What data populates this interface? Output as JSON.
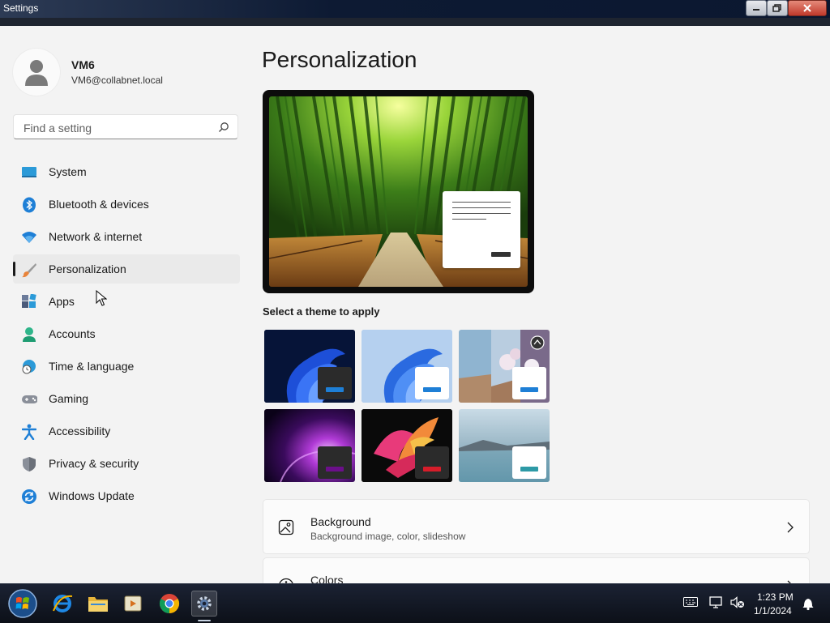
{
  "window": {
    "title": "Settings"
  },
  "profile": {
    "name": "VM6",
    "email": "VM6@collabnet.local"
  },
  "search": {
    "placeholder": "Find a setting",
    "value": ""
  },
  "nav": {
    "items": [
      {
        "label": "System",
        "icon": "monitor-icon"
      },
      {
        "label": "Bluetooth & devices",
        "icon": "bluetooth-icon"
      },
      {
        "label": "Network & internet",
        "icon": "wifi-icon"
      },
      {
        "label": "Personalization",
        "icon": "brush-icon",
        "selected": true
      },
      {
        "label": "Apps",
        "icon": "apps-icon"
      },
      {
        "label": "Accounts",
        "icon": "person-icon"
      },
      {
        "label": "Time & language",
        "icon": "globe-clock-icon"
      },
      {
        "label": "Gaming",
        "icon": "gamepad-icon"
      },
      {
        "label": "Accessibility",
        "icon": "accessibility-icon"
      },
      {
        "label": "Privacy & security",
        "icon": "shield-icon"
      },
      {
        "label": "Windows Update",
        "icon": "update-icon"
      }
    ]
  },
  "main": {
    "title": "Personalization",
    "theme_section_label": "Select a theme to apply",
    "themes": [
      {
        "name": "windows-dark",
        "accent": "#0067c0"
      },
      {
        "name": "windows-light",
        "accent": "#0067c0"
      },
      {
        "name": "glow",
        "accent": "#0078d4"
      },
      {
        "name": "captured-motion",
        "accent": "#6b0f8a"
      },
      {
        "name": "flow",
        "accent": "#c50f1f"
      },
      {
        "name": "sunrise",
        "accent": "#2d7d9a"
      }
    ],
    "cards": [
      {
        "title": "Background",
        "subtitle": "Background image, color, slideshow",
        "icon": "image-icon"
      },
      {
        "title": "Colors",
        "subtitle": "",
        "icon": "palette-icon"
      }
    ]
  },
  "taskbar": {
    "apps": [
      "start-button",
      "internet-explorer-icon",
      "file-explorer-icon",
      "media-player-icon",
      "chrome-icon",
      "settings-icon"
    ],
    "time": "1:23 PM",
    "date": "1/1/2024"
  },
  "colors": {
    "accent": "#0067c0",
    "selected_indicator": "#1a1a1a"
  }
}
